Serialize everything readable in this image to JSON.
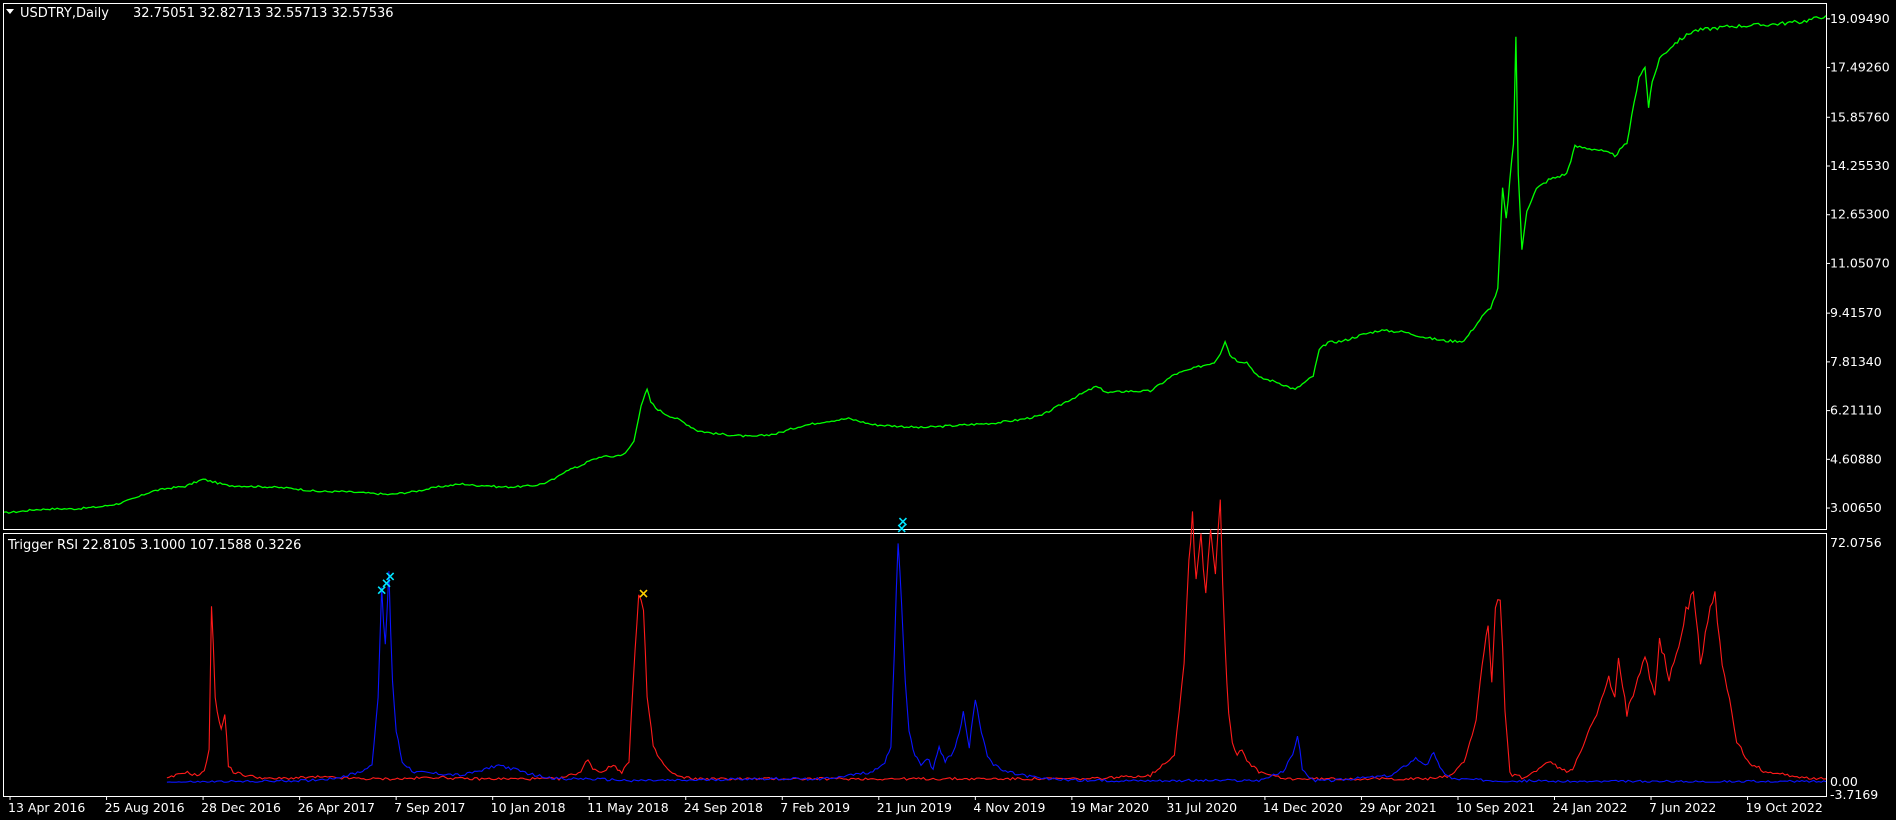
{
  "colors": {
    "background": "#000000",
    "frame": "#ffffff",
    "price_line": "#00ff00",
    "rsi_red": "#ff1a1a",
    "rsi_blue": "#0a14ff",
    "marker_cyan": "#00e5ff",
    "marker_yellow": "#ffd000"
  },
  "chart_data": [
    {
      "type": "line",
      "header_icon": "triangle-down-icon",
      "header": "USDTRY,Daily",
      "ohlc": "32.75051 32.82713 32.55713 32.57536",
      "y_ticks": [
        "19.09490",
        "17.49260",
        "15.85760",
        "14.25530",
        "12.65300",
        "11.05070",
        "9.41570",
        "7.81340",
        "6.21110",
        "4.60880",
        "3.00650"
      ],
      "y_tick_values": [
        19.0949,
        17.4926,
        15.8576,
        14.2553,
        12.653,
        11.0507,
        9.4157,
        7.8134,
        6.2111,
        4.6088,
        3.0065
      ],
      "ylim": [
        2.35,
        19.55
      ],
      "grid": false,
      "series": [
        {
          "color": "#00ff00",
          "x": [
            0,
            10,
            25,
            40,
            60,
            80,
            95,
            110,
            122,
            135,
            150,
            165,
            175,
            185,
            205,
            220,
            240,
            260,
            280,
            300,
            320,
            340,
            360,
            380,
            390,
            400,
            410,
            420,
            430,
            440,
            450,
            458,
            466,
            475,
            485,
            495,
            505,
            515,
            522,
            528,
            533,
            536,
            540,
            548,
            560,
            575,
            590,
            605,
            620,
            640,
            660,
            680,
            700,
            720,
            740,
            760,
            780,
            800,
            820,
            840,
            860,
            880,
            895,
            905,
            915,
            930,
            950,
            970,
            990,
            1003,
            1008,
            1012,
            1016,
            1022,
            1030,
            1040,
            1055,
            1070,
            1080,
            1085,
            1090,
            1097,
            1110,
            1125,
            1140,
            1160,
            1180,
            1195,
            1210,
            1225,
            1232,
            1238,
            1242,
            1245,
            1248,
            1251,
            1253,
            1255,
            1258,
            1262,
            1270,
            1280,
            1295,
            1302,
            1320,
            1335,
            1345,
            1355,
            1360,
            1363,
            1366,
            1372,
            1385,
            1400,
            1430,
            1460,
            1490,
            1510
          ],
          "y": [
            2.85,
            2.88,
            2.95,
            2.98,
            2.98,
            3.05,
            3.15,
            3.35,
            3.55,
            3.65,
            3.72,
            3.95,
            3.85,
            3.75,
            3.72,
            3.7,
            3.65,
            3.55,
            3.55,
            3.5,
            3.45,
            3.55,
            3.7,
            3.8,
            3.75,
            3.75,
            3.7,
            3.7,
            3.72,
            3.75,
            3.85,
            4.0,
            4.25,
            4.35,
            4.55,
            4.7,
            4.7,
            4.8,
            5.2,
            6.4,
            6.9,
            6.5,
            6.3,
            6.1,
            5.9,
            5.55,
            5.45,
            5.4,
            5.35,
            5.45,
            5.7,
            5.85,
            5.95,
            5.75,
            5.7,
            5.65,
            5.7,
            5.75,
            5.8,
            5.9,
            6.05,
            6.5,
            6.8,
            7.0,
            6.8,
            6.85,
            6.85,
            7.4,
            7.65,
            7.8,
            8.1,
            8.5,
            8.05,
            7.85,
            7.8,
            7.3,
            7.15,
            6.9,
            7.2,
            7.35,
            8.2,
            8.45,
            8.5,
            8.7,
            8.85,
            8.8,
            8.6,
            8.5,
            8.5,
            9.3,
            9.6,
            10.2,
            13.5,
            12.5,
            13.8,
            15.0,
            18.5,
            14.0,
            11.5,
            12.8,
            13.5,
            13.8,
            14.0,
            14.9,
            14.8,
            14.6,
            15.0,
            17.2,
            17.5,
            16.2,
            17.0,
            17.8,
            18.3,
            18.7,
            18.85,
            18.9,
            19.0,
            19.2
          ]
        }
      ]
    },
    {
      "type": "line",
      "header": "Trigger RSI 22.8105 3.1000 107.1588 0.3226",
      "y_ticks": [
        "72.0756",
        "0.00",
        "-3.7169"
      ],
      "y_tick_values": [
        72.0756,
        0.0,
        -3.7169
      ],
      "ylim": [
        -3.7169,
        72.0756
      ],
      "grid": false,
      "series": [
        {
          "color": "#ff1a1a",
          "x": [
            135,
            150,
            160,
            166,
            170,
            172,
            175,
            180,
            183,
            186,
            190,
            200,
            220,
            260,
            300,
            330,
            360,
            380,
            400,
            430,
            460,
            478,
            484,
            488,
            495,
            505,
            512,
            518,
            523,
            526,
            530,
            533,
            538,
            545,
            552,
            560,
            575,
            600,
            640,
            700,
            800,
            900,
            950,
            970,
            978,
            982,
            985,
            988,
            992,
            996,
            1000,
            1004,
            1008,
            1012,
            1015,
            1018,
            1022,
            1026,
            1030,
            1040,
            1060,
            1100,
            1150,
            1180,
            1200,
            1210,
            1215,
            1220,
            1225,
            1230,
            1233,
            1236,
            1240,
            1244,
            1248,
            1250,
            1254,
            1260,
            1280,
            1295,
            1300,
            1305,
            1320,
            1330,
            1335,
            1338,
            1345,
            1352,
            1360,
            1368,
            1372,
            1380,
            1388,
            1394,
            1400,
            1406,
            1412,
            1418,
            1422,
            1426,
            1430,
            1436,
            1445,
            1460,
            1480,
            1500,
            1510
          ],
          "y": [
            1,
            3,
            2,
            3,
            10,
            52,
            25,
            15,
            20,
            5,
            3,
            2,
            1,
            1.5,
            1,
            1,
            1.5,
            1,
            1,
            1,
            1,
            3,
            7,
            4,
            3,
            5,
            3,
            6,
            40,
            55,
            50,
            25,
            10,
            6,
            3,
            1.5,
            1,
            1,
            1,
            1,
            1,
            1,
            2,
            8,
            35,
            65,
            78,
            60,
            72,
            55,
            75,
            62,
            80,
            40,
            20,
            12,
            8,
            10,
            6,
            3,
            1,
            1,
            1,
            1,
            2,
            6,
            12,
            18,
            35,
            45,
            30,
            50,
            55,
            20,
            3,
            2,
            2,
            1,
            6,
            3,
            4,
            8,
            20,
            30,
            25,
            35,
            20,
            28,
            38,
            25,
            42,
            30,
            40,
            50,
            55,
            35,
            48,
            55,
            40,
            30,
            25,
            12,
            6,
            3,
            2,
            1,
            1
          ]
        },
        {
          "color": "#0a14ff",
          "x": [
            135,
            200,
            250,
            270,
            285,
            295,
            305,
            310,
            313,
            316,
            319,
            322,
            325,
            330,
            340,
            380,
            410,
            420,
            430,
            440,
            460,
            480,
            520,
            560,
            620,
            680,
            720,
            730,
            735,
            738,
            741,
            744,
            747,
            750,
            755,
            760,
            765,
            770,
            775,
            780,
            785,
            790,
            795,
            800,
            805,
            810,
            815,
            820,
            830,
            860,
            900,
            960,
            1040,
            1060,
            1068,
            1072,
            1076,
            1080,
            1085,
            1100,
            1150,
            1170,
            1180,
            1185,
            1190,
            1200,
            1240,
            1300,
            1400,
            1510
          ],
          "y": [
            0,
            0.2,
            0.5,
            1,
            2,
            3,
            5,
            25,
            55,
            40,
            60,
            30,
            15,
            6,
            3,
            2,
            5,
            4,
            3,
            2,
            1,
            1,
            0.5,
            0.5,
            1,
            1,
            3,
            6,
            10,
            40,
            72,
            50,
            30,
            15,
            8,
            5,
            7,
            4,
            10,
            6,
            8,
            12,
            20,
            10,
            25,
            15,
            8,
            5,
            3,
            1,
            0.5,
            0.5,
            0.5,
            3,
            8,
            14,
            4,
            2,
            0.5,
            0.5,
            2,
            7,
            5,
            9,
            4,
            1,
            0.5,
            0.2,
            0.2,
            0.2
          ]
        }
      ],
      "markers": [
        {
          "color": "#00e5ff",
          "x": 313,
          "y": 56
        },
        {
          "color": "#00e5ff",
          "x": 317,
          "y": 58
        },
        {
          "color": "#00e5ff",
          "x": 320,
          "y": 60
        },
        {
          "color": "#ffd000",
          "x": 530,
          "y": 55
        },
        {
          "color": "#00e5ff",
          "x": 744,
          "y": 74
        },
        {
          "color": "#00e5ff",
          "x": 745,
          "y": 76
        }
      ],
      "x_ticks": [
        "13 Apr 2016",
        "25 Aug 2016",
        "28 Dec 2016",
        "26 Apr 2017",
        "7 Sep 2017",
        "10 Jan 2018",
        "11 May 2018",
        "24 Sep 2018",
        "7 Feb 2019",
        "21 Jun 2019",
        "4 Nov 2019",
        "19 Mar 2020",
        "31 Jul 2020",
        "14 Dec 2020",
        "29 Apr 2021",
        "10 Sep 2021",
        "24 Jan 2022",
        "7 Jun 2022",
        "19 Oct 2022"
      ],
      "x_tick_positions": [
        5,
        85,
        165,
        245,
        325,
        405,
        485,
        565,
        645,
        725,
        805,
        885,
        965,
        1045,
        1125,
        1205,
        1285,
        1365,
        1445
      ]
    }
  ]
}
